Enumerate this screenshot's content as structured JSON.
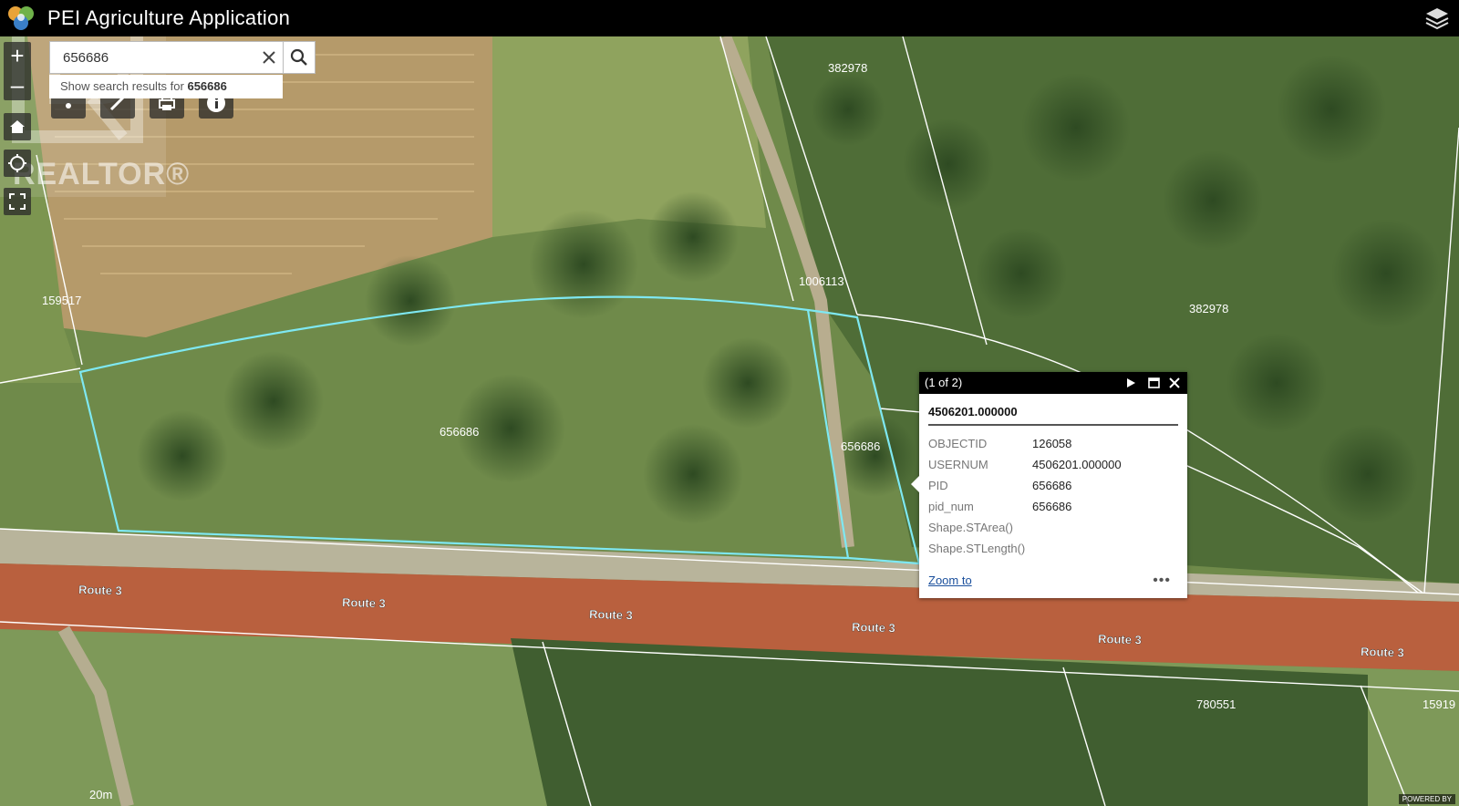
{
  "app": {
    "title": "PEI Agriculture Application"
  },
  "watermark": {
    "text": "REALTOR®"
  },
  "search": {
    "value": "656686",
    "suggestion_prefix": "Show search results for",
    "suggestion_term": "656686"
  },
  "zoom": {
    "in_label": "+",
    "out_label": "–"
  },
  "map": {
    "parcel_labels": [
      "382978",
      "1006113",
      "382978",
      "159517",
      "656686",
      "656686",
      "780551",
      "15919"
    ],
    "road_labels": [
      "Route 3",
      "Route 3",
      "Route 3",
      "Route 3",
      "Route 3",
      "Route 3"
    ],
    "scale_label": "20m",
    "powered_by": "POWERED BY",
    "colors": {
      "highlight": "#7ee8f2",
      "road": "#b9603e",
      "boundary": "#ffffff"
    }
  },
  "popup": {
    "counter": "(1 of 2)",
    "feature_title": "4506201.000000",
    "fields": [
      {
        "key": "OBJECTID",
        "value": "126058"
      },
      {
        "key": "USERNUM",
        "value": "4506201.000000"
      },
      {
        "key": "PID",
        "value": "656686"
      },
      {
        "key": "pid_num",
        "value": "656686"
      },
      {
        "key": "Shape.STArea()",
        "value": ""
      },
      {
        "key": "Shape.STLength()",
        "value": ""
      }
    ],
    "zoom_link": "Zoom to",
    "more": "•••"
  }
}
